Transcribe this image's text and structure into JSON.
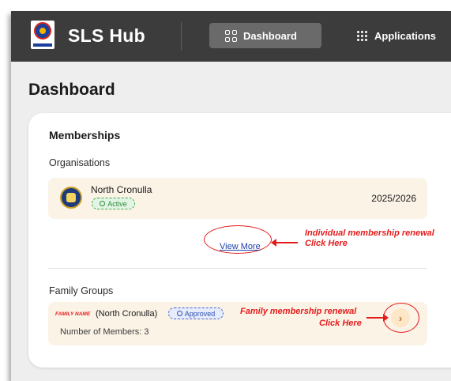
{
  "header": {
    "app_title": "SLS Hub",
    "nav": [
      {
        "label": "Dashboard",
        "icon": "dashboard-grid-icon",
        "active": true
      },
      {
        "label": "Applications",
        "icon": "apps-grid-icon",
        "active": false
      }
    ]
  },
  "page": {
    "title": "Dashboard"
  },
  "memberships": {
    "title": "Memberships",
    "organisations_label": "Organisations",
    "org": {
      "name": "North Cronulla",
      "status": "Active",
      "period": "2025/2026"
    },
    "view_more_label": "View More",
    "annotation_individual": [
      "Individual membership renewal",
      "Click Here"
    ],
    "family_groups_label": "Family Groups",
    "family": {
      "name_tag": "FAMILY NAME",
      "club": "(North Cronulla)",
      "status": "Approved",
      "members_text": "Number of Members: 3"
    },
    "annotation_family": [
      "Family membership renewal",
      "Click Here"
    ],
    "chevron": "›"
  },
  "colors": {
    "header_bg": "#3c3c3c",
    "active_nav_bg": "#6a6a6a",
    "annotation_red": "#e51b1b",
    "row_bg": "#fbf3e6",
    "active_green": "#2c8a36",
    "approved_blue": "#2e4fb0",
    "link_blue": "#1e3ea8"
  }
}
